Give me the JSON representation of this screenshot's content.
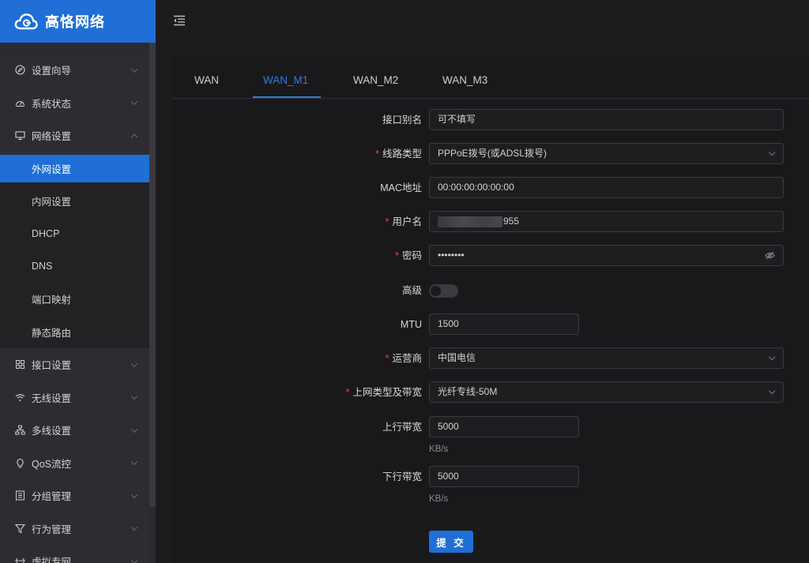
{
  "brand": {
    "name": "高恪网络"
  },
  "sidebar": {
    "items": [
      {
        "label": "设置向导",
        "icon": "compass-icon"
      },
      {
        "label": "系统状态",
        "icon": "dashboard-icon"
      },
      {
        "label": "网络设置",
        "icon": "monitor-icon",
        "open": true,
        "children": [
          {
            "label": "外网设置",
            "active": true
          },
          {
            "label": "内网设置"
          },
          {
            "label": "DHCP"
          },
          {
            "label": "DNS"
          },
          {
            "label": "端口映射"
          },
          {
            "label": "静态路由"
          }
        ]
      },
      {
        "label": "接口设置",
        "icon": "grid-icon"
      },
      {
        "label": "无线设置",
        "icon": "wifi-icon"
      },
      {
        "label": "多线设置",
        "icon": "network-icon"
      },
      {
        "label": "QoS流控",
        "icon": "bulb-icon"
      },
      {
        "label": "分组管理",
        "icon": "list-icon"
      },
      {
        "label": "行为管理",
        "icon": "filter-icon"
      },
      {
        "label": "虚拟专网",
        "icon": "vpn-icon"
      }
    ]
  },
  "tabs": [
    {
      "label": "WAN"
    },
    {
      "label": "WAN_M1",
      "active": true
    },
    {
      "label": "WAN_M2"
    },
    {
      "label": "WAN_M3"
    }
  ],
  "form": {
    "alias": {
      "label": "接口别名",
      "value": "可不填写"
    },
    "line_type": {
      "label": "线路类型",
      "required": true,
      "value": "PPPoE拨号(或ADSL拨号)"
    },
    "mac": {
      "label": "MAC地址",
      "value": "00:00:00:00:00:00"
    },
    "username": {
      "label": "用户名",
      "required": true,
      "value_suffix": "955"
    },
    "password": {
      "label": "密码",
      "required": true,
      "value": "••••••••"
    },
    "advanced": {
      "label": "高级",
      "enabled": false
    },
    "mtu": {
      "label": "MTU",
      "value": "1500"
    },
    "isp": {
      "label": "运营商",
      "required": true,
      "value": "中国电信"
    },
    "access_type": {
      "label": "上网类型及带宽",
      "required": true,
      "value": "光纤专线-50M"
    },
    "upload": {
      "label": "上行带宽",
      "value": "5000",
      "unit": "KB/s"
    },
    "download": {
      "label": "下行带宽",
      "value": "5000",
      "unit": "KB/s"
    },
    "submit_label": "提 交"
  },
  "colors": {
    "accent": "#1f6fd6",
    "required": "#e5484d"
  }
}
